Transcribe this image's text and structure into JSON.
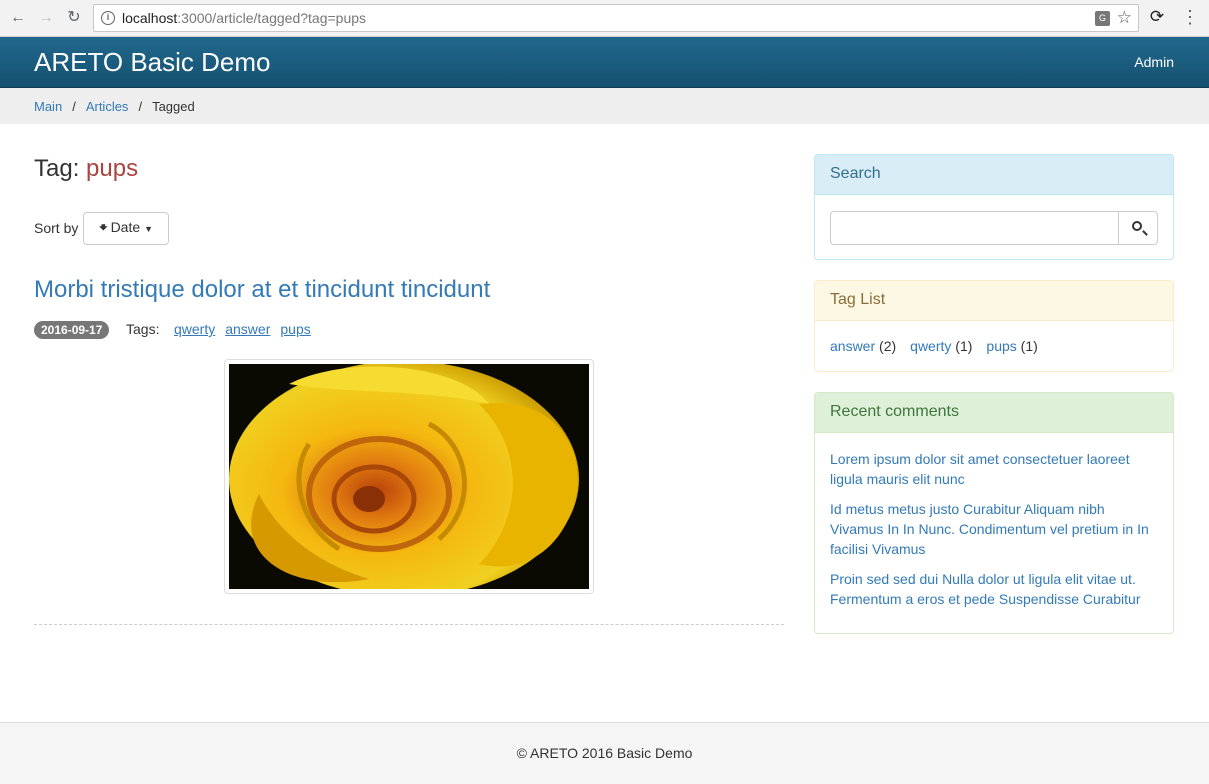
{
  "browser": {
    "url_host": "localhost",
    "url_rest": ":3000/article/tagged?tag=pups"
  },
  "navbar": {
    "brand": "ARETO Basic Demo",
    "admin_label": "Admin"
  },
  "breadcrumb": {
    "items": [
      "Main",
      "Articles",
      "Tagged"
    ],
    "separator": "/"
  },
  "page": {
    "heading_prefix": "Tag:",
    "tag": "pups",
    "sort_label": "Sort by",
    "sort_button": "Date"
  },
  "article": {
    "title": "Morbi tristique dolor at et tincidunt tincidunt",
    "date": "2016-09-17",
    "tags_label": "Tags:",
    "tags": [
      "qwerty",
      "answer",
      "pups"
    ]
  },
  "sidebar": {
    "search": {
      "title": "Search",
      "value": ""
    },
    "tag_list": {
      "title": "Tag List",
      "tags": [
        {
          "name": "answer",
          "count": "(2)"
        },
        {
          "name": "qwerty",
          "count": "(1)"
        },
        {
          "name": "pups",
          "count": "(1)"
        }
      ]
    },
    "recent_comments": {
      "title": "Recent comments",
      "items": [
        "Lorem ipsum dolor sit amet consectetuer laoreet ligula mauris elit nunc",
        "Id metus metus justo Curabitur Aliquam nibh Vivamus In In Nunc. Condimentum vel pretium in In facilisi Vivamus",
        "Proin sed sed dui Nulla dolor ut ligula elit vitae ut. Fermentum a eros et pede Suspendisse Curabitur"
      ]
    }
  },
  "footer": {
    "text": "© ARETO 2016 Basic Demo"
  },
  "colors": {
    "navbar": "#1b5f82",
    "link": "#337ab7",
    "tag_highlight": "#a94442"
  }
}
